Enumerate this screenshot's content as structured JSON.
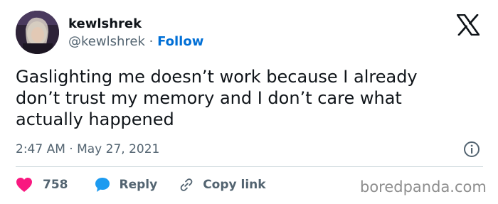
{
  "tweet": {
    "display_name": "kewlshrek",
    "handle": "@kewlshrek",
    "separator": "·",
    "follow_label": "Follow",
    "text": "Gaslighting me doesn’t work because I already\ndon’t trust my memory and I don’t care what\nactually happened",
    "timestamp": "2:47 AM · May 27, 2021"
  },
  "actions": {
    "like_count": "758",
    "reply_label": "Reply",
    "copy_link_label": "Copy link"
  },
  "watermark": "boredpanda.com",
  "icons": {
    "like": "heart-icon",
    "reply": "speech-bubble-icon",
    "copy": "link-icon",
    "info": "info-icon",
    "logo": "x-logo-icon"
  },
  "colors": {
    "like": "#f91880",
    "reply": "#1d9bf0",
    "follow": "#006fd6",
    "secondary_text": "#536471"
  }
}
